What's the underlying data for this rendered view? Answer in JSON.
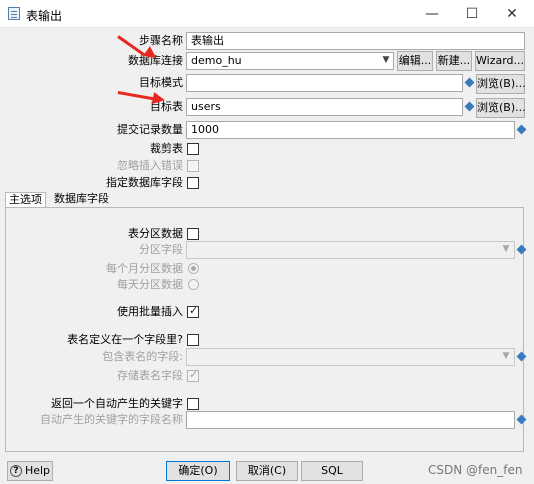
{
  "window": {
    "title": "表输出"
  },
  "fields": {
    "step_name": {
      "label": "步骤名称",
      "value": "表输出"
    },
    "db_connection": {
      "label": "数据库连接",
      "value": "demo_hu",
      "edit_label": "编辑...",
      "new_label": "新建...",
      "wizard_label": "Wizard..."
    },
    "target_schema": {
      "label": "目标模式",
      "value": "",
      "browse_label": "浏览(B)..."
    },
    "target_table": {
      "label": "目标表",
      "value": "users",
      "browse_label": "浏览(B)..."
    },
    "commit_size": {
      "label": "提交记录数量",
      "value": "1000"
    },
    "truncate_table": {
      "label": "裁剪表",
      "checked": false
    },
    "ignore_insert_errors": {
      "label": "忽略插入错误",
      "checked": false,
      "disabled": true
    },
    "specify_db_fields": {
      "label": "指定数据库字段",
      "checked": false
    }
  },
  "tabs": [
    {
      "label": "主选项",
      "active": true
    },
    {
      "label": "数据库字段",
      "active": false
    }
  ],
  "main_options": {
    "partition_table": {
      "label": "表分区数据",
      "checked": false
    },
    "partition_field": {
      "label": "分区字段",
      "value": "",
      "disabled": true
    },
    "partition_monthly": {
      "label": "每个月分区数据",
      "selected": true,
      "disabled": true
    },
    "partition_daily": {
      "label": "每天分区数据",
      "selected": false,
      "disabled": true
    },
    "use_batch_insert": {
      "label": "使用批量插入",
      "checked": true
    },
    "table_name_in_field": {
      "label": "表名定义在一个字段里?",
      "checked": false
    },
    "field_with_table_name": {
      "label": "包含表名的字段:",
      "value": "",
      "disabled": true
    },
    "store_table_name_field": {
      "label": "存储表名字段",
      "checked": true,
      "disabled": true
    },
    "return_auto_key": {
      "label": "返回一个自动产生的关键字",
      "checked": false
    },
    "auto_key_field_name": {
      "label": "自动产生的关键字的字段名称",
      "value": ""
    }
  },
  "footer": {
    "help_label": "Help",
    "ok_label": "确定(O)",
    "cancel_label": "取消(C)",
    "sql_label": "SQL",
    "watermark": "CSDN @fen_fen"
  },
  "colors": {
    "annotation_arrow": "#e8281e",
    "variable_diamond": "#3a7bbf",
    "ok_border": "#0078d7"
  }
}
